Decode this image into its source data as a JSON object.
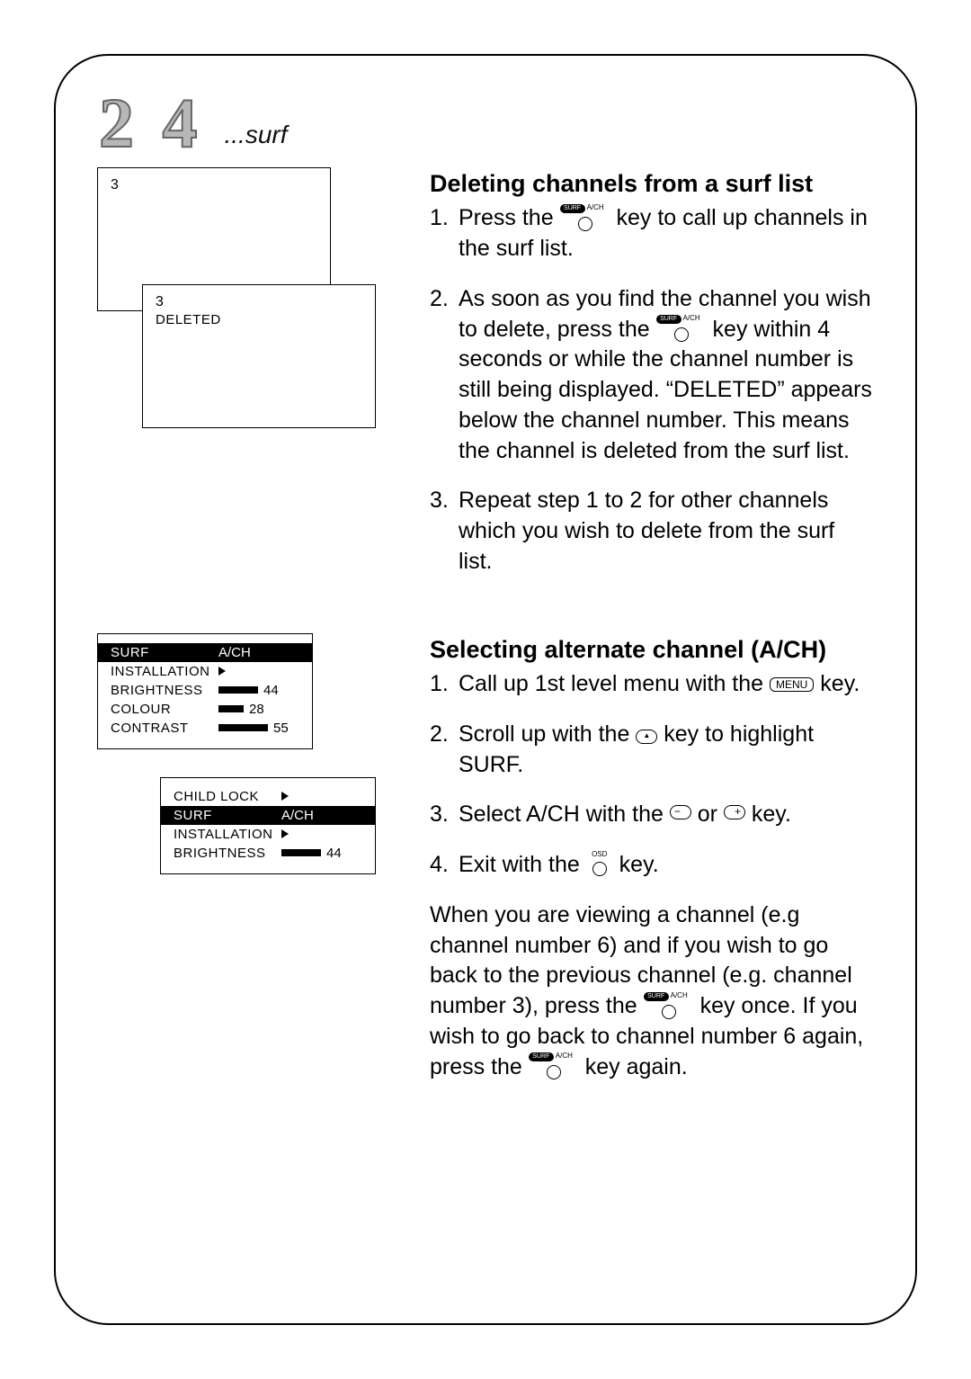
{
  "header": {
    "page_number": "2 4",
    "suffix": "...surf"
  },
  "illustration1": {
    "channel_number": "3",
    "deleted_channel_number": "3",
    "deleted_label": "DELETED"
  },
  "section_delete": {
    "heading": "Deleting channels from a surf list",
    "step1_a": "Press the ",
    "step1_b": " key to call up channels in the surf list.",
    "step2_a": "As soon as you find the channel you wish to delete, press the ",
    "step2_b": " key within 4 seconds or while the channel number is still being displayed. “DELETED” appears below the channel number. This means the channel is deleted from the surf list.",
    "step3": "Repeat step 1 to 2 for other channels which you wish to delete from the surf list."
  },
  "menu_screen1": {
    "rows": [
      {
        "label": "SURF",
        "value": "A/CH",
        "highlight": true
      },
      {
        "label": "INSTALLATION",
        "type": "arrow"
      },
      {
        "label": "BRIGHTNESS",
        "type": "bar",
        "bar": 44,
        "value": "44"
      },
      {
        "label": "COLOUR",
        "type": "bar",
        "bar": 28,
        "value": "28"
      },
      {
        "label": "CONTRAST",
        "type": "bar",
        "bar": 55,
        "value": "55"
      }
    ]
  },
  "menu_screen2": {
    "rows": [
      {
        "label": "CHILD LOCK",
        "type": "arrow"
      },
      {
        "label": "SURF",
        "value": "A/CH",
        "highlight": true
      },
      {
        "label": "INSTALLATION",
        "type": "arrow"
      },
      {
        "label": "BRIGHTNESS",
        "type": "bar",
        "bar": 44,
        "value": "44"
      }
    ]
  },
  "section_ach": {
    "heading": "Selecting alternate channel (A/CH)",
    "step1_a": "Call up 1st level menu with the ",
    "step1_b": " key.",
    "step2_a": "Scroll up with the ",
    "step2_b": " key to highlight SURF.",
    "step3_a": "Select A/CH with the ",
    "step3_or": " or ",
    "step3_b": " key.",
    "step4_a": "Exit with the ",
    "step4_b": " key.",
    "paragraph_a": "When you are viewing a channel (e.g channel number 6) and if you wish to go back to the previous channel (e.g. channel number 3), press the ",
    "paragraph_b": " key once.  If you wish to go back to channel number 6 again, press the ",
    "paragraph_c": " key again."
  },
  "key_labels": {
    "surf_pill": "SURF",
    "surf_ach": "A/CH",
    "menu": "MENU",
    "osd": "OSD"
  }
}
